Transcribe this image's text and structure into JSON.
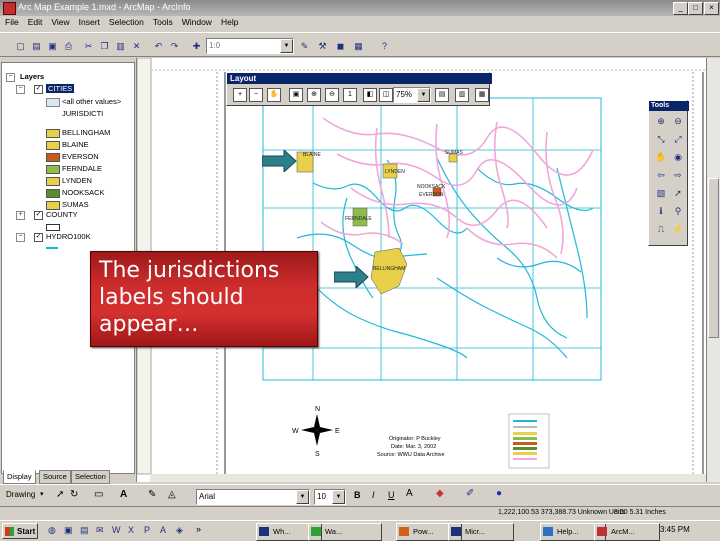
{
  "window": {
    "title": "Arc Map Example 1.mxd - ArcMap - ArcInfo",
    "min": "_",
    "max": "□",
    "close": "×"
  },
  "menu": [
    "File",
    "Edit",
    "View",
    "Insert",
    "Selection",
    "Tools",
    "Window",
    "Help"
  ],
  "toolbar": {
    "scale_value": "1:0",
    "layer_placeholder": ""
  },
  "toc": {
    "root": "Layers",
    "layer1": "CITIES",
    "layer1_other": "<all other values>",
    "layer1_field": "JURISDICTI",
    "cities": [
      {
        "name": "BELLINGHAM",
        "color": "#e8d04a"
      },
      {
        "name": "BLAINE",
        "color": "#e8d04a"
      },
      {
        "name": "EVERSON",
        "color": "#c85a20"
      },
      {
        "name": "FERNDALE",
        "color": "#8cbc4a"
      },
      {
        "name": "LYNDEN",
        "color": "#e8d04a"
      },
      {
        "name": "NOOKSACK",
        "color": "#5e8c2c"
      },
      {
        "name": "SUMAS",
        "color": "#e8d04a"
      }
    ],
    "layer2": "COUNTY",
    "layer3": "HYDRO100K",
    "tabs": [
      "Display",
      "Source",
      "Selection"
    ]
  },
  "layout_toolbar": {
    "title": "Layout",
    "zoom": "75%"
  },
  "tools_palette": {
    "title": "Tools"
  },
  "map": {
    "labels": [
      "BLAINE",
      "SUMAS",
      "LYNDEN",
      "NOOKSACK",
      "EVERSON",
      "FERNDALE",
      "BELLINGHAM"
    ],
    "north": "N",
    "south": "S",
    "east": "E",
    "west": "W",
    "credits": [
      "Originator: P Buckley",
      "Date: Mar. 3, 2002",
      "Source: WWU Data Archive"
    ]
  },
  "callout": {
    "text": "The jurisdictions labels should appear…"
  },
  "drawbar": {
    "drawing_label": "Drawing",
    "font": "Arial",
    "size": "10",
    "bold": "B",
    "italic": "I",
    "underline": "U"
  },
  "status": {
    "coords": "1,222,100.53 373,388.73 Unknown Units",
    "inches": "8.00 5.31 Inches"
  },
  "taskbar": {
    "start": "Start",
    "tasks": [
      "Wh...",
      "Wa...",
      "Pow...",
      "Micr...",
      "Help...",
      "ArcM..."
    ],
    "clock": "3:45 PM"
  },
  "colors": {
    "hydro": "#1fb8d8",
    "roads_pink": "#f0a8d8",
    "callout_red": "#c82424",
    "city_yellow": "#e8d04a",
    "titlebar_active": "#0a246a"
  }
}
